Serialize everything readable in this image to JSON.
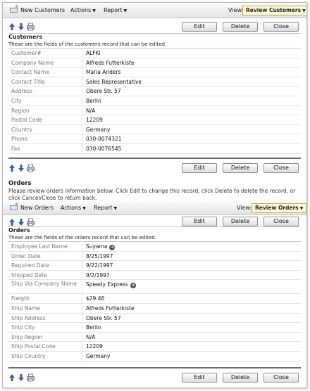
{
  "customers": {
    "toolbar": {
      "new_label": "New Customers",
      "actions_label": "Actions",
      "report_label": "Report",
      "view_label": "View:",
      "view_value": "Review Customers"
    },
    "buttons": {
      "edit": "Edit",
      "delete": "Delete",
      "close": "Close"
    },
    "title": "Customers",
    "description": "These are the fields of the customers record that can be edited.",
    "fields": [
      {
        "label": "Customer#",
        "value": "ALFKI"
      },
      {
        "label": "Company Name",
        "value": "Alfreds Futterkiste"
      },
      {
        "label": "Contact Name",
        "value": "Maria Anders"
      },
      {
        "label": "Contact Title",
        "value": "Sales Representative"
      },
      {
        "label": "Address",
        "value": "Obere Str. 57"
      },
      {
        "label": "City",
        "value": "Berlin"
      },
      {
        "label": "Region",
        "value": "N/A"
      },
      {
        "label": "Postal Code",
        "value": "12209"
      },
      {
        "label": "Country",
        "value": "Germany"
      },
      {
        "label": "Phone",
        "value": "030-0074321"
      },
      {
        "label": "Fax",
        "value": "030-0076545"
      }
    ]
  },
  "orders_intro": {
    "heading": "Orders",
    "text": "Please review orders information below. Click Edit to change this record, click Delete to delete the record, or click Cancel/Close to return back."
  },
  "orders": {
    "toolbar": {
      "new_label": "New Orders",
      "actions_label": "Actions",
      "report_label": "Report",
      "view_label": "View:",
      "view_value": "Review Orders"
    },
    "buttons": {
      "edit": "Edit",
      "delete": "Delete",
      "close": "Close"
    },
    "title": "Orders",
    "description": "These are the fields of the orders record that can be edited.",
    "fields": [
      {
        "label": "Employee Last Name",
        "value": "Suyama"
      },
      {
        "label": "Order Date",
        "value": "8/25/1997"
      },
      {
        "label": "Required Date",
        "value": "9/22/1997"
      },
      {
        "label": "Shipped Date",
        "value": "9/2/1997"
      },
      {
        "label": "Ship Via Company Name",
        "value": "Speedy Express"
      },
      {
        "label": "Freight",
        "value": "$29.46"
      },
      {
        "label": "Ship Name",
        "value": "Alfreds Futterkiste"
      },
      {
        "label": "Ship Address",
        "value": "Obere Str. 57"
      },
      {
        "label": "Ship City",
        "value": "Berlin"
      },
      {
        "label": "Ship Region",
        "value": "N/A"
      },
      {
        "label": "Ship Postal Code",
        "value": "12209"
      },
      {
        "label": "Ship Country",
        "value": "Germany"
      }
    ]
  },
  "colors": {
    "accent_border": "#c9a94a",
    "accent_fill": "#fff8d8",
    "arrow_blue": "#3a5f9a",
    "label_gray": "#777777"
  },
  "icons": [
    "new-record-icon",
    "up-arrow-icon",
    "down-arrow-icon",
    "print-icon",
    "go-arrow-icon"
  ]
}
